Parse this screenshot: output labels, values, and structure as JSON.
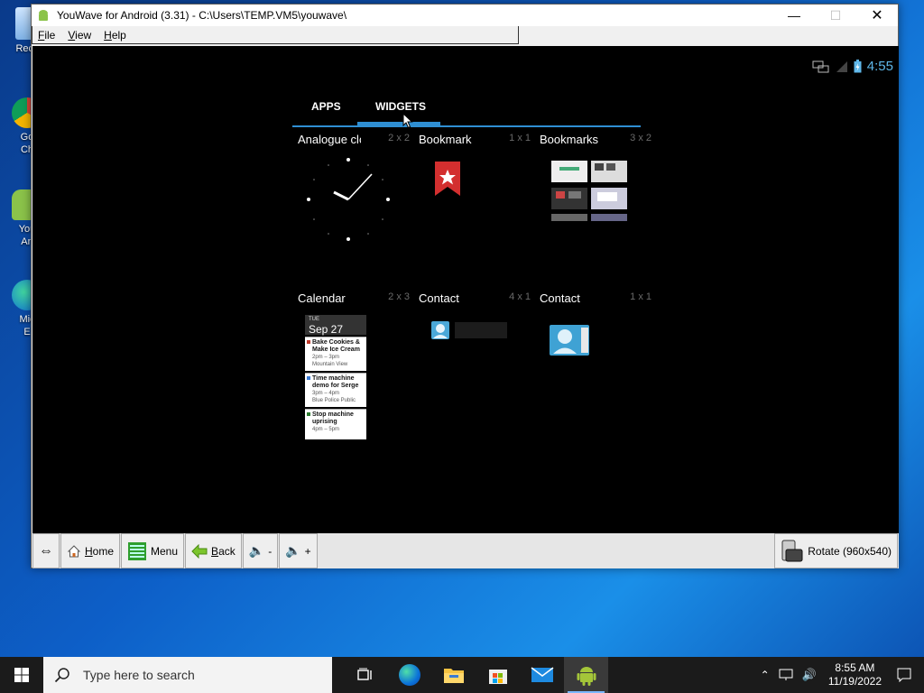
{
  "desktop": {
    "icons": [
      {
        "label": "Recy"
      },
      {
        "label": "Go\nCh"
      },
      {
        "label": "You\nAn"
      },
      {
        "label": "Mic\nE"
      }
    ]
  },
  "window": {
    "title": "YouWave for Android (3.31) - C:\\Users\\TEMP.VM5\\youwave\\",
    "menu": [
      "File",
      "View",
      "Help"
    ]
  },
  "android": {
    "status_time": "4:55",
    "tabs": [
      {
        "label": "APPS"
      },
      {
        "label": "WIDGETS",
        "selected": true
      }
    ],
    "widgets": [
      {
        "name": "Analogue clo",
        "size": "2 x 2"
      },
      {
        "name": "Bookmark",
        "size": "1 x 1"
      },
      {
        "name": "Bookmarks",
        "size": "3 x 2"
      },
      {
        "name": "Calendar",
        "size": "2 x 3"
      },
      {
        "name": "Contact",
        "size": "4 x 1"
      },
      {
        "name": "Contact",
        "size": "1 x 1"
      }
    ],
    "calendar_preview": {
      "dow": "TUE",
      "date": "Sep 27",
      "events": [
        {
          "title": "Bake Cookies & Make Ice Cream",
          "time": "2pm – 3pm",
          "place": "Mountain View"
        },
        {
          "title": "Time machine demo for Serge",
          "time": "3pm – 4pm",
          "place": "Blue Police Public"
        },
        {
          "title": "Stop machine uprising",
          "time": "4pm – 5pm",
          "place": ""
        }
      ]
    }
  },
  "toolbar": {
    "arrows": "⇔",
    "home": "Home",
    "menu": "Menu",
    "back": "Back",
    "vol_down": "-",
    "vol_up": "+",
    "rotate": "Rotate (960x540)"
  },
  "taskbar": {
    "search_placeholder": "Type here to search",
    "time": "8:55 AM",
    "date": "11/19/2022",
    "accent": "#7ab7ff"
  }
}
